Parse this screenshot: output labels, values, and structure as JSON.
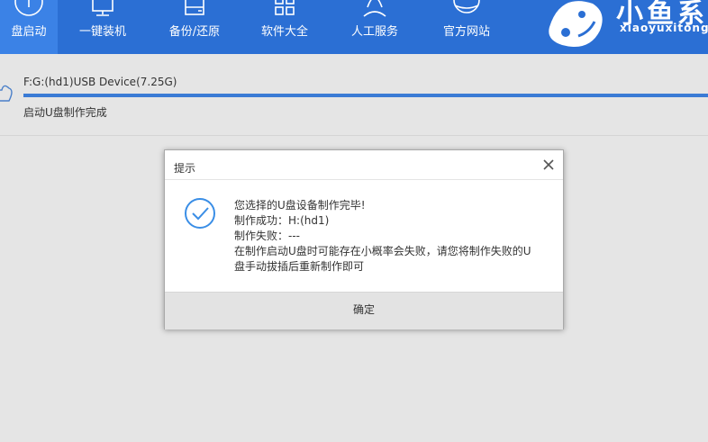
{
  "colors": {
    "nav_bg": "#2b6fd4",
    "nav_active_bg": "#3b82e6",
    "progress": "#3a7bd5",
    "check_icon": "#3a8ee6"
  },
  "nav": {
    "items": [
      {
        "label": "盘启动",
        "icon": "usb-disk-icon",
        "active": true
      },
      {
        "label": "一键装机",
        "icon": "monitor-icon",
        "active": false
      },
      {
        "label": "备份/还原",
        "icon": "backup-icon",
        "active": false
      },
      {
        "label": "软件大全",
        "icon": "apps-grid-icon",
        "active": false
      },
      {
        "label": "人工服务",
        "icon": "customer-service-icon",
        "active": false
      },
      {
        "label": "官方网站",
        "icon": "globe-icon",
        "active": false
      }
    ],
    "brand_cn": "小鱼系",
    "brand_en": "xiaoyuxitong"
  },
  "device": {
    "name": "F:G:(hd1)USB Device(7.25G)",
    "progress": 1.0,
    "status": "启动U盘制作完成"
  },
  "dialog": {
    "title": "提示",
    "lines": [
      "您选择的U盘设备制作完毕!",
      "制作成功：H:(hd1)",
      "制作失败：---",
      "在制作启动U盘时可能存在小概率会失败，请您将制作失败的U",
      "盘手动拔插后重新制作即可"
    ],
    "ok_label": "确定"
  }
}
